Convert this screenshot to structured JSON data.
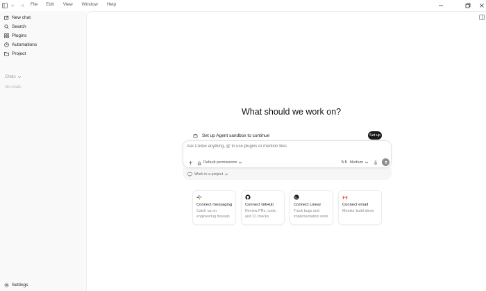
{
  "menu": [
    "File",
    "Edit",
    "View",
    "Window",
    "Help"
  ],
  "sidebar": {
    "items": [
      {
        "label": "New chat",
        "icon": "edit-icon"
      },
      {
        "label": "Search",
        "icon": "search-icon"
      },
      {
        "label": "Plugins",
        "icon": "grid-icon"
      },
      {
        "label": "Automations",
        "icon": "clock-icon"
      },
      {
        "label": "Project",
        "icon": "folder-icon"
      }
    ],
    "chats_label": "Chats",
    "no_chats": "No chats",
    "settings_label": "Settings"
  },
  "main": {
    "heading": "What should we work on?",
    "setup_notice": "Set up Agent sandbox to continue",
    "setup_button": "Set up",
    "composer": {
      "placeholder": "Ask Codex anything, @ to use plugins or mention files",
      "permissions": "Default permissions",
      "model_version": "5.5",
      "model_effort": "Medium"
    },
    "project_selector": "Work in a project",
    "cards": [
      {
        "title": "Connect messaging",
        "desc": "Catch up on engineering threads",
        "icon": "slack-icon"
      },
      {
        "title": "Connect GitHub",
        "desc": "Review PRs, code, and CI checks",
        "icon": "github-icon"
      },
      {
        "title": "Connect Linear",
        "desc": "Track bugs and implementation work",
        "icon": "linear-icon"
      },
      {
        "title": "Connect email",
        "desc": "Monitor build alerts",
        "icon": "gmail-icon"
      }
    ]
  },
  "colors": {
    "sidebar_bg": "#f9f9f9",
    "send_button": "#8d8d8d",
    "setup_button": "#1a1a1a",
    "gmail_red": "#ea4335"
  }
}
